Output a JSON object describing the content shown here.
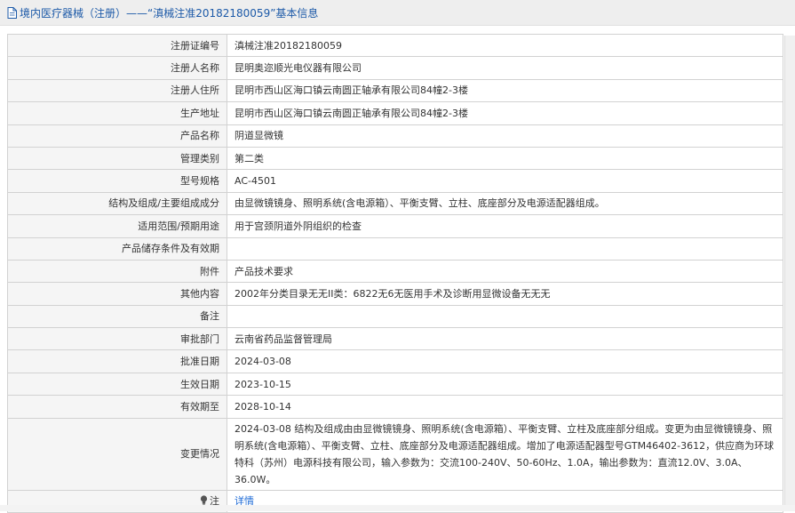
{
  "header": {
    "icon": "document-icon",
    "title": "境内医疗器械（注册）——“滇械注准20182180059”基本信息"
  },
  "rows": [
    {
      "label": "注册证编号",
      "value": "滇械注准20182180059"
    },
    {
      "label": "注册人名称",
      "value": "昆明奥迩顺光电仪器有限公司"
    },
    {
      "label": "注册人住所",
      "value": "昆明市西山区海口镇云南圆正轴承有限公司84幢2-3楼"
    },
    {
      "label": "生产地址",
      "value": "昆明市西山区海口镇云南圆正轴承有限公司84幢2-3楼"
    },
    {
      "label": "产品名称",
      "value": "阴道显微镜"
    },
    {
      "label": "管理类别",
      "value": "第二类"
    },
    {
      "label": "型号规格",
      "value": "AC-4501"
    },
    {
      "label": "结构及组成/主要组成成分",
      "value": "由显微镜镜身、照明系统(含电源箱）、平衡支臂、立柱、底座部分及电源适配器组成。"
    },
    {
      "label": "适用范围/预期用途",
      "value": "用于宫颈阴道外阴组织的检查"
    },
    {
      "label": "产品储存条件及有效期",
      "value": ""
    },
    {
      "label": "附件",
      "value": "产品技术要求"
    },
    {
      "label": "其他内容",
      "value": "2002年分类目录无无II类：6822无6无医用手术及诊断用显微设备无无无"
    },
    {
      "label": "备注",
      "value": ""
    },
    {
      "label": "审批部门",
      "value": "云南省药品监督管理局"
    },
    {
      "label": "批准日期",
      "value": "2024-03-08"
    },
    {
      "label": "生效日期",
      "value": "2023-10-15"
    },
    {
      "label": "有效期至",
      "value": "2028-10-14"
    }
  ],
  "change_row": {
    "label": "变更情况",
    "value": "2024-03-08 结构及组成由由显微镜镜身、照明系统(含电源箱）、平衡支臂、立柱及底座部分组成。变更为由显微镜镜身、照明系统(含电源箱）、平衡支臂、立柱、底座部分及电源适配器组成。增加了电源适配器型号GTM46402-3612，供应商为环球特科（苏州）电源科技有限公司，输入参数为：交流100-240V、50-60Hz、1.0A，输出参数为：直流12.0V、3.0A、36.0W。"
  },
  "note_row": {
    "label": "注",
    "icon": "lightbulb-icon",
    "link_text": "详情"
  },
  "colors": {
    "header_text": "#1d5aa8",
    "link": "#1d6ad6",
    "label_bg": "#f5f5f5",
    "border": "#d2d2d2"
  }
}
